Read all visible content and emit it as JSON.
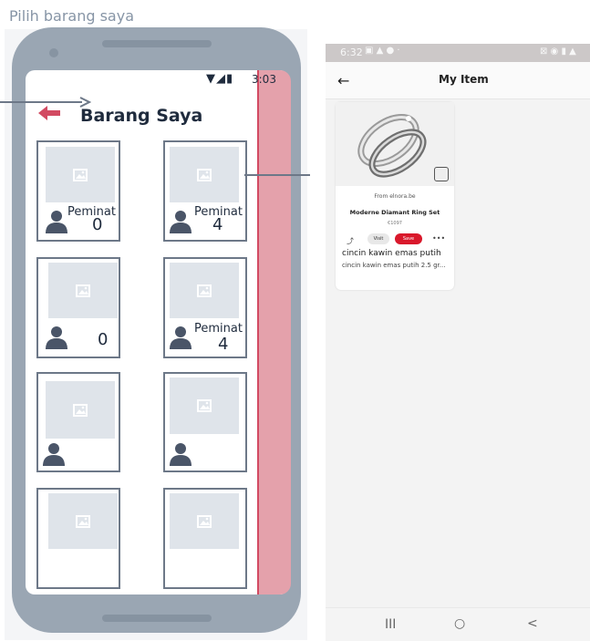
{
  "frame_title": "Pilih barang saya",
  "phone": {
    "status_time": "3:03",
    "status_icons": "▼◢▮",
    "title": "Barang Saya",
    "peminat_label": "Peminat",
    "items": [
      {
        "label": "Peminat",
        "count": "0"
      },
      {
        "label": "Peminat",
        "count": "4"
      },
      {
        "label": "",
        "count": "0"
      },
      {
        "label": "Peminat",
        "count": "4"
      },
      {
        "label": "",
        "count": ""
      },
      {
        "label": "",
        "count": ""
      },
      {
        "label": "",
        "count": ""
      },
      {
        "label": "",
        "count": ""
      }
    ]
  },
  "app": {
    "status_time": "6:32",
    "status_icons": "▣ ▲ ● ·",
    "status_right": "⊠ ◉ ▮ ▲",
    "title": "My Item",
    "item": {
      "source": "From elnora.be",
      "product_name": "Moderne Diamant Ring Set",
      "price": "€1097",
      "visit_label": "Visit",
      "save_label": "Save",
      "title": "cincin kawin emas putih",
      "description": "cincin kawin emas putih 2.5 gr..."
    },
    "nav": {
      "recent": "III",
      "home": "○",
      "back": "<"
    }
  },
  "colors": {
    "accent": "#d24a62",
    "wire": "#6d7888",
    "placeholder": "#dfe4ea"
  }
}
